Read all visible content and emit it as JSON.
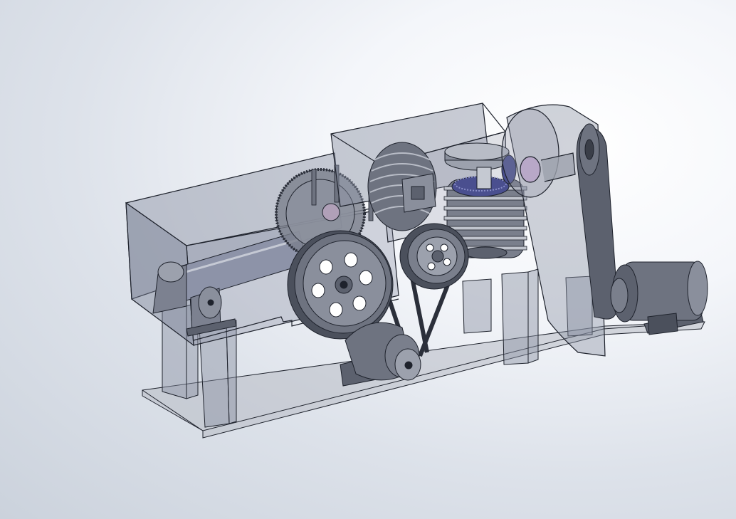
{
  "scene": {
    "colors": {
      "background_light": "#ffffff",
      "background_dark": "#cbd2dc",
      "housing_fill": "#8a90a2",
      "housing_edge": "#1e222c",
      "metal_dark": "#4b505c",
      "metal_mid": "#6e7380",
      "metal_light": "#9ca1ad",
      "gear_blue": "#4a4f8f",
      "base_plate": "#b8bcc4"
    },
    "parts": [
      "base-plate",
      "support-legs",
      "left-hopper-housing",
      "right-hopper-housing",
      "roller-shaft",
      "pillow-block-bearings",
      "ring-gear",
      "finned-cylinder-left",
      "finned-cylinder-right",
      "bevel-gear-assembly",
      "large-pulley",
      "small-pulley",
      "drive-motor-bottom",
      "v-belt",
      "side-pulley-housing",
      "side-belt",
      "drive-motor-right"
    ]
  }
}
